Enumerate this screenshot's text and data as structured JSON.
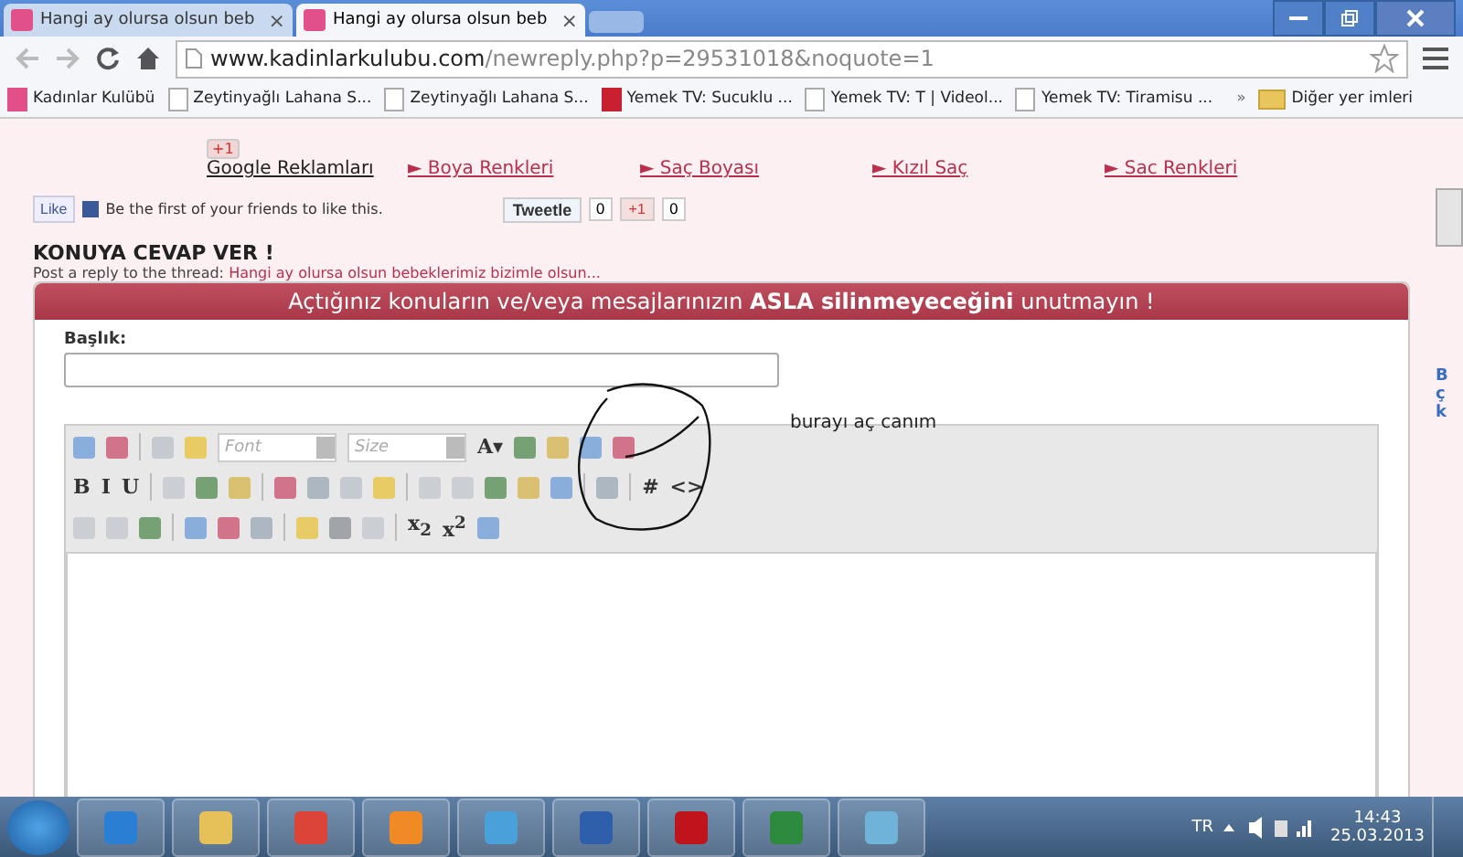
{
  "tabs": [
    {
      "label": "Hangi ay olursa olsun beb",
      "selected": false,
      "close": "×"
    },
    {
      "label": "Hangi ay olursa olsun beb",
      "selected": true,
      "close": "×"
    }
  ],
  "address": {
    "domain": "www.kadinlarkulubu.com",
    "path": "/newreply.php?p=29531018&noquote=1"
  },
  "bookmarks": [
    "Kadınlar Kulübü",
    "Zeytinyağlı Lahana S...",
    "Zeytinyağlı Lahana S...",
    "Yemek TV: Sucuklu ...",
    "Yemek TV: T | Videol...",
    "Yemek TV: Tiramisu ..."
  ],
  "bookmarks_more": "»",
  "other_bookmarks": "Diğer yer imleri",
  "ads": {
    "title": "Google Reklamları",
    "gplus": "+1",
    "links": [
      "► Boya Renkleri",
      "► Saç Boyası",
      "► Kızıl Saç",
      "► Sac Renkleri"
    ]
  },
  "social": {
    "like": "Like",
    "fb_text": "Be the first of your friends to like this.",
    "tweet": "Tweetle",
    "tweet_count": "0",
    "plus": "+1",
    "plus_count": "0"
  },
  "heading": "KONUYA CEVAP VER !",
  "thread_prefix": "Post a reply to the thread:",
  "thread_link": "Hangi ay olursa olsun bebeklerimiz bizimle olsun...",
  "banner": "Açtığınız konuların ve/veya mesajlarınızın **ASLA silinmeyeceğini** unutmayın !",
  "title_label": "Başlık:",
  "annotation": "burayı aç canım",
  "toolbar_rows": [
    [
      {
        "kind": "icon"
      },
      {
        "kind": "icon"
      },
      {
        "kind": "sep"
      },
      {
        "kind": "icon"
      },
      {
        "kind": "icon"
      },
      {
        "kind": "select",
        "label": "Font"
      },
      {
        "kind": "select",
        "label": "Size"
      },
      {
        "kind": "glyph",
        "label": "A▾"
      },
      {
        "kind": "icon"
      },
      {
        "kind": "icon"
      },
      {
        "kind": "icon"
      },
      {
        "kind": "icon"
      }
    ],
    [
      {
        "kind": "glyph",
        "label": "B"
      },
      {
        "kind": "glyph",
        "label": "I"
      },
      {
        "kind": "glyph",
        "label": "U"
      },
      {
        "kind": "sep"
      },
      {
        "kind": "icon"
      },
      {
        "kind": "icon"
      },
      {
        "kind": "icon"
      },
      {
        "kind": "sep"
      },
      {
        "kind": "icon"
      },
      {
        "kind": "icon"
      },
      {
        "kind": "icon"
      },
      {
        "kind": "icon"
      },
      {
        "kind": "sep"
      },
      {
        "kind": "icon"
      },
      {
        "kind": "icon"
      },
      {
        "kind": "icon"
      },
      {
        "kind": "icon"
      },
      {
        "kind": "icon"
      },
      {
        "kind": "sep"
      },
      {
        "kind": "icon"
      },
      {
        "kind": "sep"
      },
      {
        "kind": "glyph",
        "label": "#"
      },
      {
        "kind": "glyph",
        "label": "<>"
      }
    ],
    [
      {
        "kind": "icon"
      },
      {
        "kind": "icon"
      },
      {
        "kind": "icon"
      },
      {
        "kind": "sep"
      },
      {
        "kind": "icon"
      },
      {
        "kind": "icon"
      },
      {
        "kind": "icon"
      },
      {
        "kind": "sep"
      },
      {
        "kind": "icon"
      },
      {
        "kind": "icon"
      },
      {
        "kind": "icon"
      },
      {
        "kind": "sep"
      },
      {
        "kind": "glyph",
        "label": "x$_{2}$"
      },
      {
        "kind": "glyph",
        "label": "x$^{2}$"
      },
      {
        "kind": "icon"
      }
    ]
  ],
  "side_letters": [
    "B",
    "ç",
    "k"
  ],
  "tray": {
    "lang": "TR",
    "time": "14:43",
    "date": "25.03.2013"
  }
}
